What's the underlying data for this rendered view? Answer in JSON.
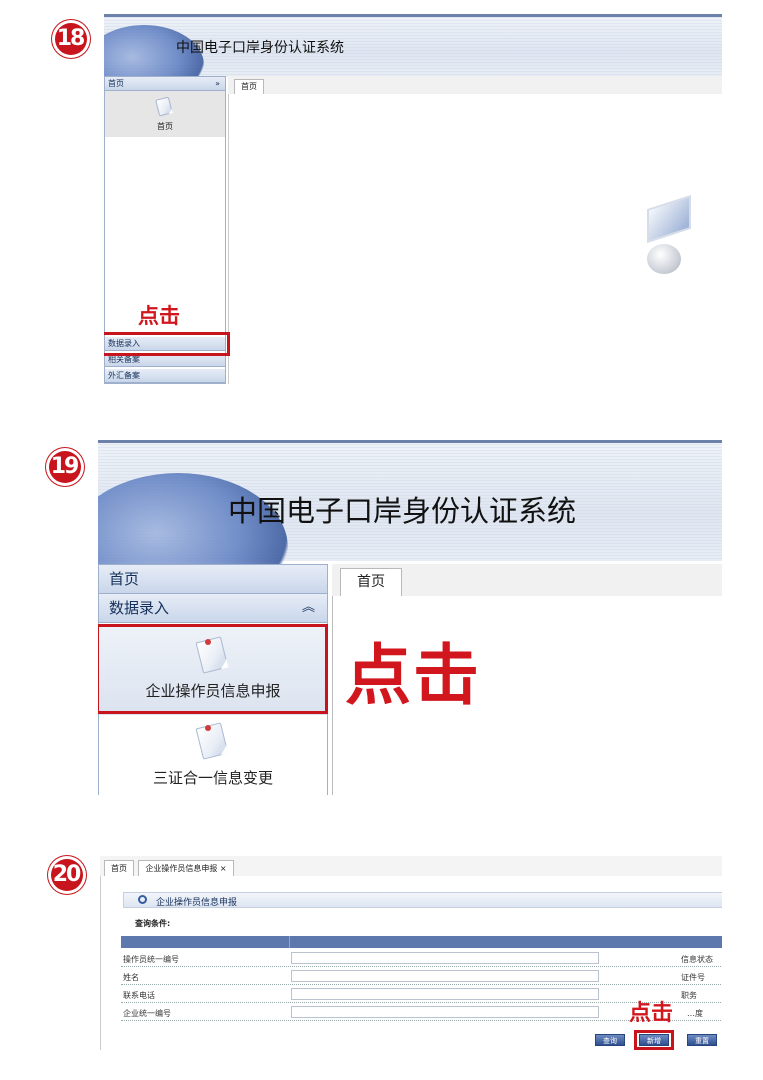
{
  "steps": [
    {
      "number": "18",
      "click_label": "点击"
    },
    {
      "number": "19",
      "click_label": "点击"
    },
    {
      "number": "20",
      "click_label": "点击"
    }
  ],
  "app": {
    "title": "中国电子口岸身份认证系统"
  },
  "step18": {
    "sidebar_header": "首页",
    "sidebar_item": "首页",
    "tab": "首页",
    "menu_items": [
      "数据录入",
      "相关备案",
      "外汇备案"
    ]
  },
  "step19": {
    "sidebar_header_home": "首页",
    "sidebar_header_data": "数据录入",
    "collapse_icon": "double-chevron-up-icon",
    "items": [
      "企业操作员信息申报",
      "三证合一信息变更"
    ],
    "tab": "首页"
  },
  "step20": {
    "tabs": [
      "首页",
      "企业操作员信息申报 ×"
    ],
    "panel_title": "企业操作员信息申报",
    "query_label": "查询条件:",
    "fields_left": [
      "操作员统一编号",
      "姓名",
      "联系电话",
      "企业统一编号"
    ],
    "fields_right": [
      "信息状态",
      "证件号",
      "职务",
      "…度"
    ],
    "buttons": [
      "查询",
      "新增",
      "重置"
    ]
  },
  "colors": {
    "accent_red": "#c8141c",
    "banner_blue": "#6c82aa",
    "header_blue": "#15305a"
  }
}
